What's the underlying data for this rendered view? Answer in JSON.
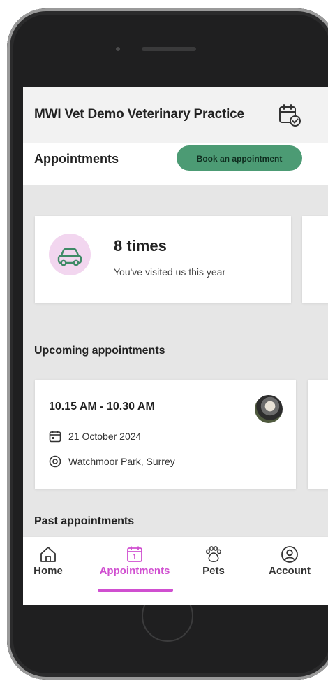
{
  "header": {
    "practice_name": "MWI Vet Demo Veterinary Practice"
  },
  "appointments_bar": {
    "title": "Appointments",
    "book_label": "Book an appointment"
  },
  "visits": {
    "count_text": "8 times",
    "subtitle": "You've visited us this year"
  },
  "upcoming": {
    "title": "Upcoming appointments",
    "items": [
      {
        "time": "10.15 AM - 10.30 AM",
        "date": "21 October 2024",
        "location": "Watchmoor Park, Surrey"
      }
    ]
  },
  "past": {
    "title": "Past appointments"
  },
  "nav": {
    "items": [
      {
        "label": "Home",
        "icon": "home-icon"
      },
      {
        "label": "Appointments",
        "icon": "calendar-icon",
        "active": true
      },
      {
        "label": "Pets",
        "icon": "paw-icon"
      },
      {
        "label": "Account",
        "icon": "user-circle-icon"
      }
    ]
  },
  "colors": {
    "accent": "#d04fd0",
    "book_button": "#4c9b74",
    "visit_icon_bg": "#f2d6ef",
    "car_icon": "#3f8a67"
  }
}
